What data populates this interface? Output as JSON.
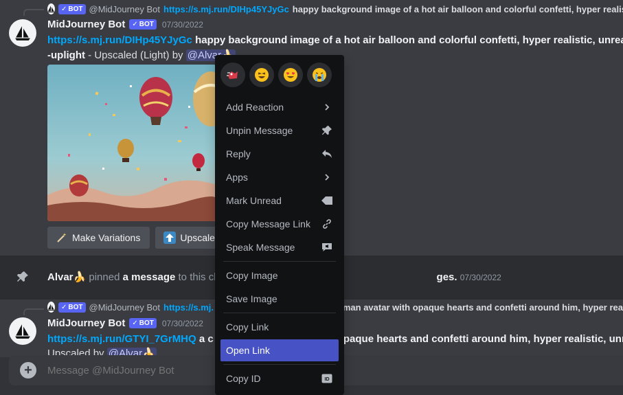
{
  "messages": [
    {
      "reply": {
        "user": "@MidJourney Bot",
        "bot_tag": "BOT",
        "link": "https://s.mj.run/DIHp45YJyGc",
        "text": "happy background image of a hot air balloon and colorful confetti, hyper realistic, unreal en"
      },
      "username": "MidJourney Bot",
      "bot_tag": "BOT",
      "timestamp": "07/30/2022",
      "link": "https://s.mj.run/DIHp45YJyGc",
      "prompt": "happy background image of a hot air balloon and colorful confetti, hyper realistic, unreal en",
      "prompt_cont": "-uplight",
      "suffix": " - Upscaled (Light) by ",
      "mention": "@Alvar",
      "buttons": [
        {
          "label": "Make Variations",
          "icon": "magic-wand-icon"
        },
        {
          "label": "Upscale",
          "icon": "upscale-icon"
        }
      ]
    },
    {
      "reply": {
        "user": "@MidJourney Bot",
        "bot_tag": "BOT",
        "link": "https://s.mj.",
        "text": "g man avatar with opaque hearts and confetti around him, hyper rea"
      },
      "username": "MidJourney Bot",
      "bot_tag": "BOT",
      "timestamp": "07/30/2022",
      "link": "https://s.mj.run/GTYI_7GrMHQ",
      "prompt_start": " a c",
      "prompt_end": "opaque hearts and confetti around him, hyper realistic, unre",
      "suffix": "Upscaled by ",
      "mention": "@Alvar"
    }
  ],
  "pinned": {
    "user": "Alvar",
    "action": " pinned ",
    "target": "a message",
    "rest": " to this ch",
    "tail": "ges.",
    "timestamp": "07/30/2022"
  },
  "composer": {
    "placeholder": "Message @MidJourney Bot"
  },
  "context_menu": {
    "reactions": [
      "dash-icon",
      "laughing-icon",
      "heart-eyes-icon",
      "crying-icon"
    ],
    "items": [
      {
        "label": "Add Reaction",
        "icon": "chevron-right-icon"
      },
      {
        "label": "Unpin Message",
        "icon": "pin-icon"
      },
      {
        "label": "Reply",
        "icon": "reply-icon"
      },
      {
        "label": "Apps",
        "icon": "chevron-right-icon"
      },
      {
        "label": "Mark Unread",
        "icon": "mark-unread-icon"
      },
      {
        "label": "Copy Message Link",
        "icon": "link-icon"
      },
      {
        "label": "Speak Message",
        "icon": "speak-icon"
      },
      {
        "label": "Copy Image",
        "icon": ""
      },
      {
        "label": "Save Image",
        "icon": ""
      },
      {
        "label": "Copy Link",
        "icon": ""
      },
      {
        "label": "Open Link",
        "icon": ""
      },
      {
        "label": "Copy ID",
        "icon": "id-icon"
      }
    ]
  },
  "colors": {
    "accent": "#5865f2",
    "active_item": "#4752c4",
    "link": "#00a8fc"
  }
}
